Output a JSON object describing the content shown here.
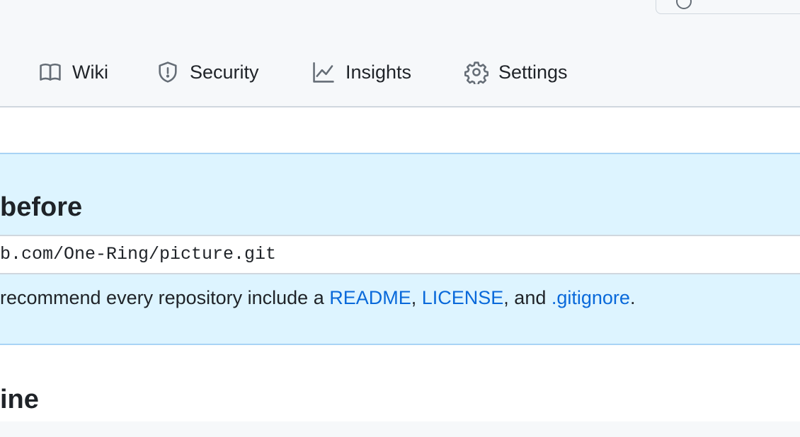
{
  "nav": {
    "tabs": [
      {
        "label": "Wiki",
        "icon": "book-icon"
      },
      {
        "label": "Security",
        "icon": "shield-icon"
      },
      {
        "label": "Insights",
        "icon": "graph-icon"
      },
      {
        "label": "Settings",
        "icon": "gear-icon"
      }
    ]
  },
  "setup": {
    "title_fragment": "before",
    "clone_url_fragment": "b.com/One-Ring/picture.git",
    "recommend_prefix": "recommend every repository include a ",
    "readme_link": "README",
    "sep1": ", ",
    "license_link": "LICENSE",
    "sep2": ", and ",
    "gitignore_link": ".gitignore",
    "suffix": "."
  },
  "next_section": {
    "title_fragment": "ine"
  },
  "colors": {
    "link": "#0969da",
    "panel_bg": "#ddf4ff",
    "header_bg": "#f6f8fa"
  }
}
